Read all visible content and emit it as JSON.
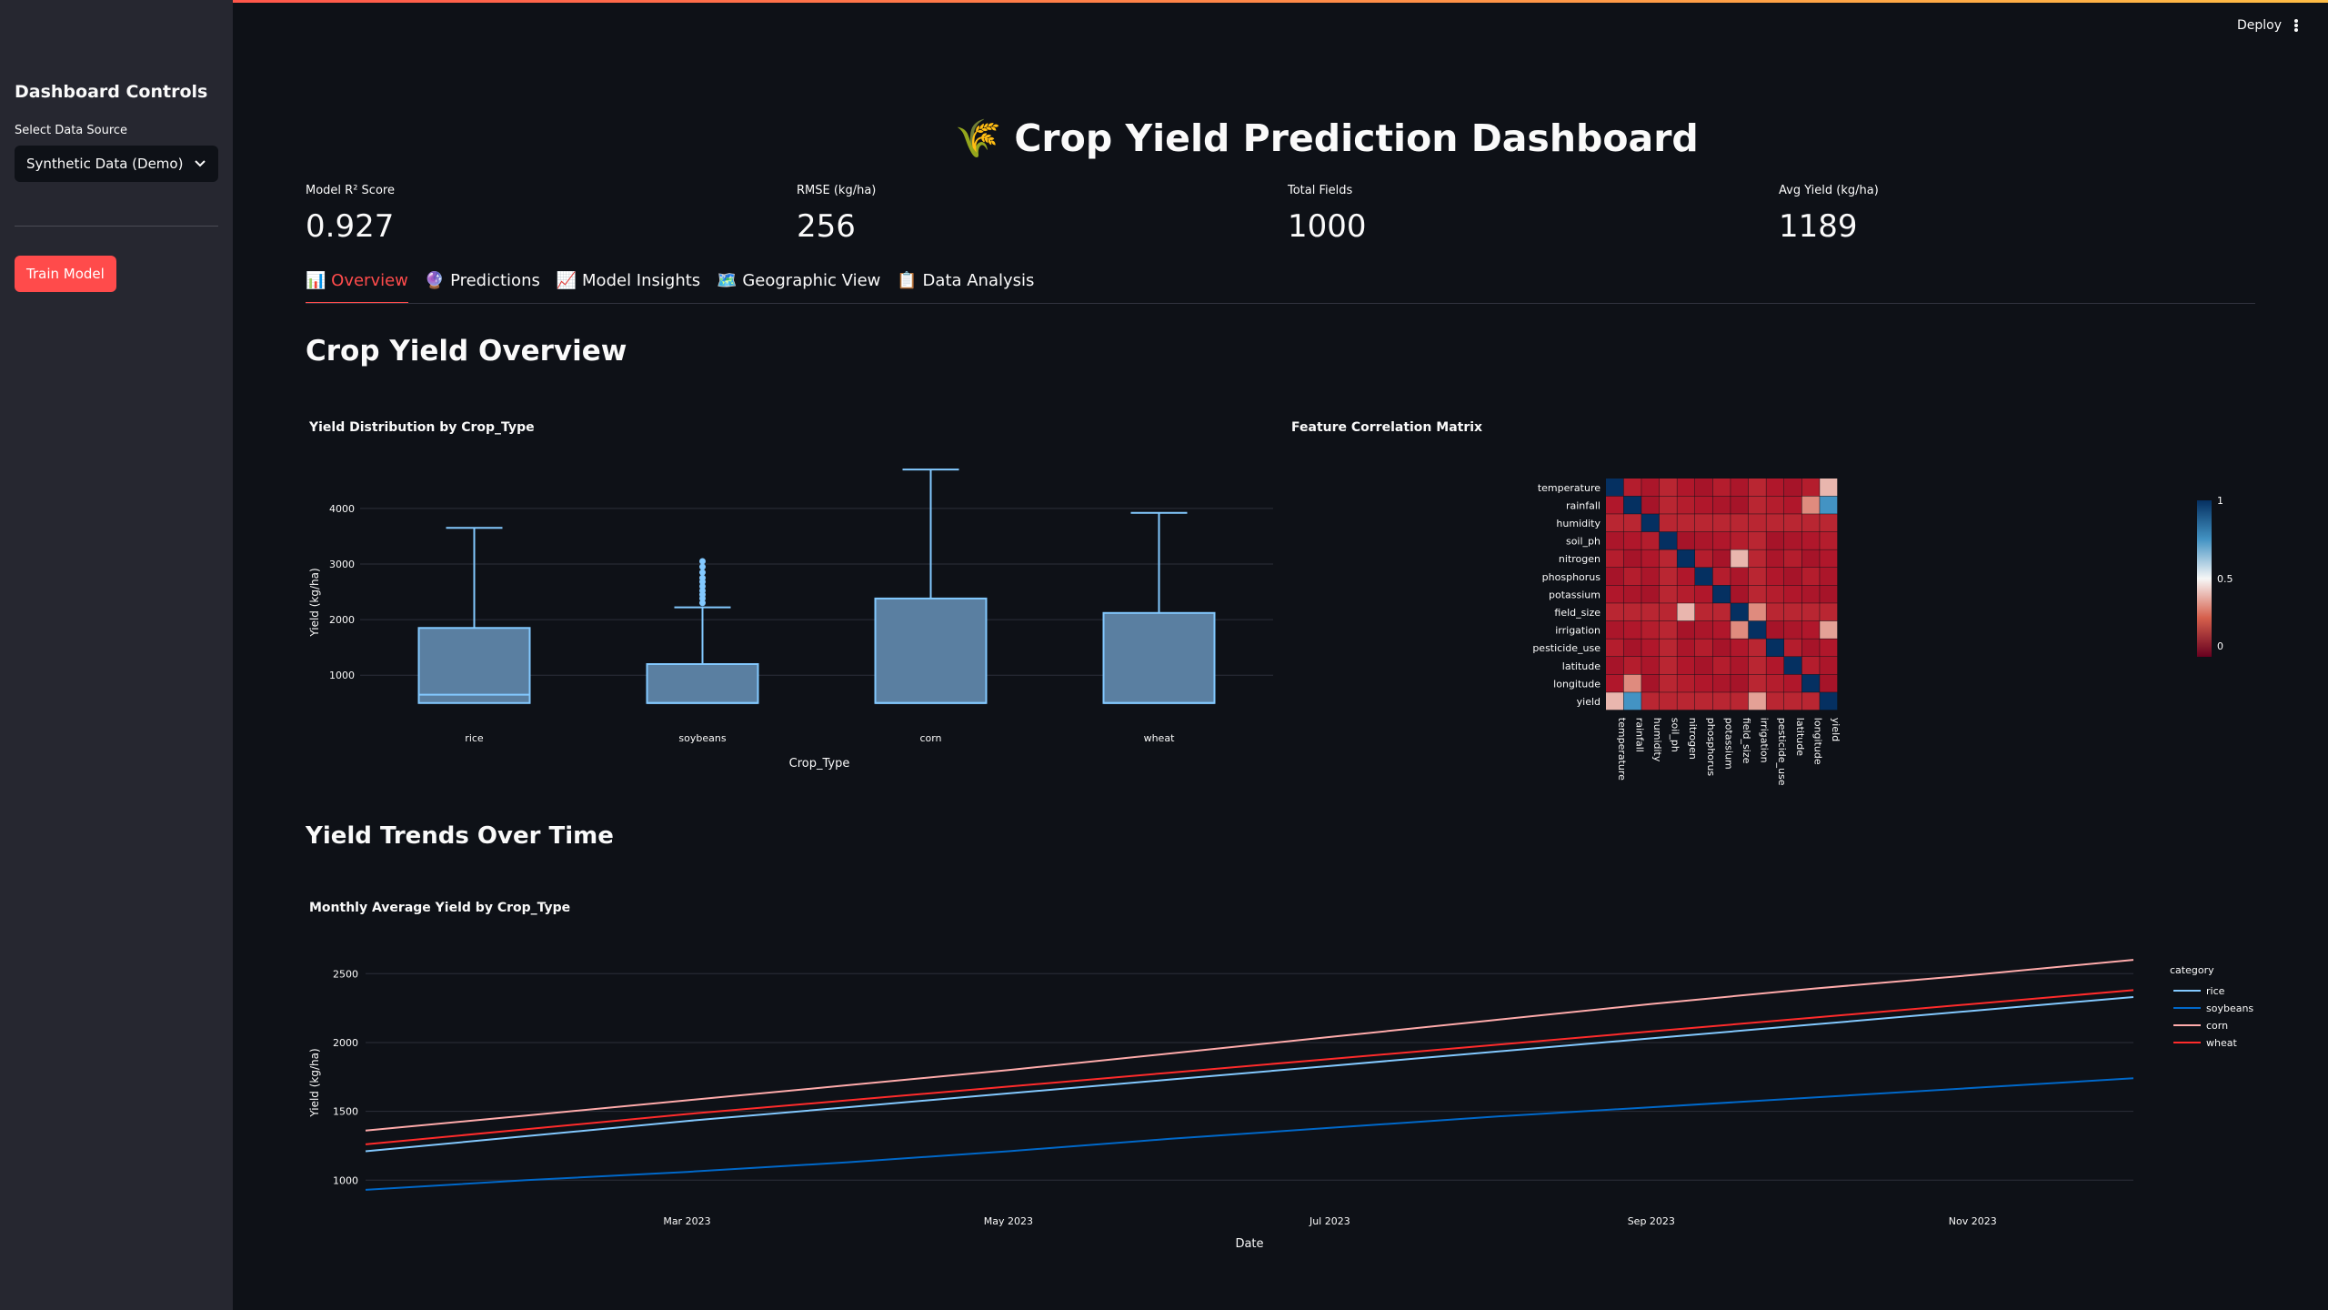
{
  "sidebar": {
    "title": "Dashboard Controls",
    "data_source_label": "Select Data Source",
    "data_source_value": "Synthetic Data (Demo)",
    "train_button": "Train Model"
  },
  "header": {
    "deploy_label": "Deploy"
  },
  "page": {
    "title_icon": "🌾",
    "title": "Crop Yield Prediction Dashboard"
  },
  "metrics": [
    {
      "label": "Model R² Score",
      "value": "0.927"
    },
    {
      "label": "RMSE (kg/ha)",
      "value": "256"
    },
    {
      "label": "Total Fields",
      "value": "1000"
    },
    {
      "label": "Avg Yield (kg/ha)",
      "value": "1189"
    }
  ],
  "tabs": [
    {
      "icon": "📊",
      "label": "Overview",
      "active": true
    },
    {
      "icon": "🔮",
      "label": "Predictions"
    },
    {
      "icon": "📈",
      "label": "Model Insights"
    },
    {
      "icon": "🗺️",
      "label": "Geographic View"
    },
    {
      "icon": "📋",
      "label": "Data Analysis"
    }
  ],
  "sections": {
    "overview": "Crop Yield Overview",
    "trends": "Yield Trends Over Time"
  },
  "colors": {
    "accent": "#ff4b4b",
    "box": "#83c9ff",
    "soybeans": "#0068c9",
    "corn": "#ffabab"
  },
  "chart_data": [
    {
      "type": "box",
      "title": "Yield Distribution by Crop_Type",
      "xlabel": "Crop_Type",
      "ylabel": "Yield (kg/ha)",
      "categories": [
        "rice",
        "soybeans",
        "corn",
        "wheat"
      ],
      "ylim": [
        300,
        4800
      ],
      "yticks": [
        1000,
        2000,
        3000,
        4000
      ],
      "boxes": [
        {
          "category": "rice",
          "min": 500,
          "q1": 500,
          "median": 650,
          "q3": 1850,
          "max": 3650,
          "outliers": []
        },
        {
          "category": "soybeans",
          "min": 500,
          "q1": 500,
          "median": 500,
          "q3": 1200,
          "max": 2220,
          "outliers": [
            2300,
            2380,
            2450,
            2520,
            2600,
            2680,
            2750,
            2850,
            2950,
            3050
          ]
        },
        {
          "category": "corn",
          "min": 500,
          "q1": 500,
          "median": 500,
          "q3": 2380,
          "max": 4700,
          "outliers": []
        },
        {
          "category": "wheat",
          "min": 500,
          "q1": 500,
          "median": 500,
          "q3": 2120,
          "max": 3920,
          "outliers": []
        }
      ]
    },
    {
      "type": "heatmap",
      "title": "Feature Correlation Matrix",
      "labels": [
        "temperature",
        "rainfall",
        "humidity",
        "soil_ph",
        "nitrogen",
        "phosphorus",
        "potassium",
        "field_size",
        "irrigation",
        "pesticide_use",
        "latitude",
        "longitude",
        "yield"
      ],
      "colorbar_ticks": [
        1,
        0.5,
        0
      ],
      "correlations": [
        {
          "a": "rainfall",
          "b": "yield",
          "value": 0.75
        },
        {
          "a": "temperature",
          "b": "yield",
          "value": 0.35
        },
        {
          "a": "nitrogen",
          "b": "field_size",
          "value": 0.35
        },
        {
          "a": "field_size",
          "b": "irrigation",
          "value": 0.25
        },
        {
          "a": "irrigation",
          "b": "yield",
          "value": 0.3
        },
        {
          "a": "rainfall",
          "b": "longitude",
          "value": 0.25
        }
      ]
    },
    {
      "type": "line",
      "title": "Monthly Average Yield by Crop_Type",
      "xlabel": "Date",
      "ylabel": "Yield (kg/ha)",
      "legend_title": "category",
      "legend_position": "right",
      "x": [
        "2023-01",
        "2023-02",
        "2023-03",
        "2023-04",
        "2023-05",
        "2023-06",
        "2023-07",
        "2023-08",
        "2023-09",
        "2023-10",
        "2023-11",
        "2023-12"
      ],
      "xticks": [
        "Mar 2023",
        "May 2023",
        "Jul 2023",
        "Sep 2023",
        "Nov 2023"
      ],
      "yticks": [
        1000,
        1500,
        2000,
        2500
      ],
      "ylim": [
        850,
        2700
      ],
      "series": [
        {
          "name": "rice",
          "color": "#83c9ff",
          "values": [
            1210,
            1320,
            1430,
            1530,
            1630,
            1730,
            1830,
            1930,
            2030,
            2130,
            2230,
            2330
          ]
        },
        {
          "name": "soybeans",
          "color": "#0068c9",
          "values": [
            930,
            1000,
            1060,
            1130,
            1210,
            1300,
            1380,
            1460,
            1530,
            1600,
            1670,
            1740
          ]
        },
        {
          "name": "corn",
          "color": "#ffabab",
          "values": [
            1360,
            1470,
            1580,
            1690,
            1800,
            1920,
            2040,
            2160,
            2280,
            2390,
            2490,
            2600
          ]
        },
        {
          "name": "wheat",
          "color": "#ff2b2b",
          "values": [
            1260,
            1370,
            1480,
            1580,
            1680,
            1780,
            1880,
            1980,
            2080,
            2180,
            2280,
            2380
          ]
        }
      ]
    }
  ]
}
